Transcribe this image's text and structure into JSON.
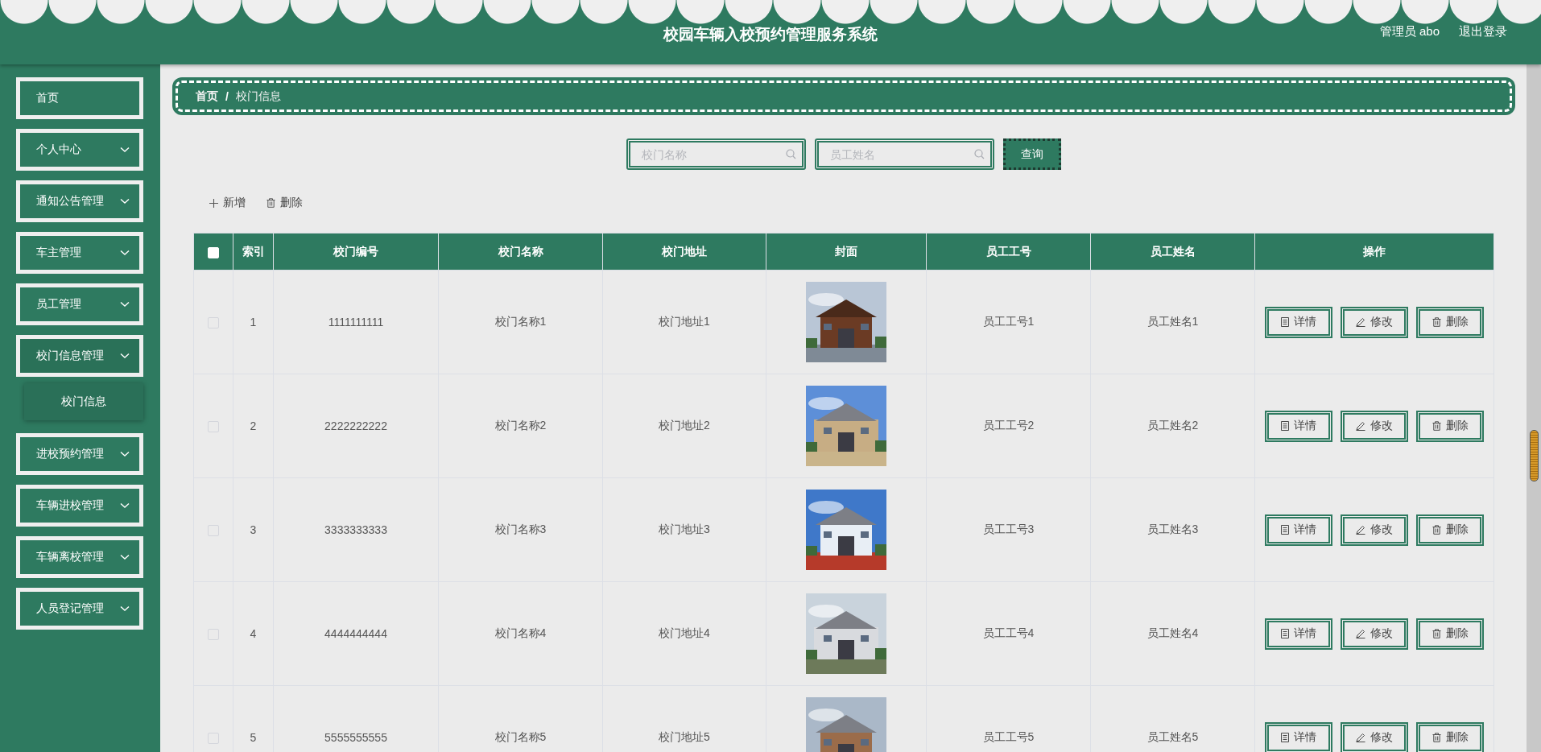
{
  "header": {
    "title": "校园车辆入校预约管理服务系统",
    "user": "管理员 abo",
    "logout": "退出登录"
  },
  "sidebar": {
    "items": [
      {
        "label": "首页",
        "kind": "link"
      },
      {
        "label": "个人中心",
        "kind": "menu"
      },
      {
        "label": "通知公告管理",
        "kind": "menu"
      },
      {
        "label": "车主管理",
        "kind": "menu"
      },
      {
        "label": "员工管理",
        "kind": "menu"
      },
      {
        "label": "校门信息管理",
        "kind": "menu",
        "children": [
          {
            "label": "校门信息",
            "selected": true
          }
        ]
      },
      {
        "label": "进校预约管理",
        "kind": "menu"
      },
      {
        "label": "车辆进校管理",
        "kind": "menu"
      },
      {
        "label": "车辆离校管理",
        "kind": "menu"
      },
      {
        "label": "人员登记管理",
        "kind": "menu"
      }
    ]
  },
  "breadcrumb": {
    "items": [
      "首页",
      "校门信息"
    ],
    "separator": "/"
  },
  "search": {
    "fields": [
      {
        "placeholder": "校门名称"
      },
      {
        "placeholder": "员工姓名"
      }
    ],
    "button": "查询"
  },
  "toolbar": [
    {
      "label": "新增",
      "kind": "add"
    },
    {
      "label": "删除",
      "kind": "delete"
    }
  ],
  "table": {
    "select_all": {
      "checked": false
    },
    "columns": [
      "索引",
      "校门编号",
      "校门名称",
      "校门地址",
      "封面",
      "员工工号",
      "员工姓名",
      "操作"
    ],
    "rows": [
      {
        "checked": false,
        "index": "1",
        "code": "1111111111",
        "name": "校门名称1",
        "address": "校门地址1",
        "staff_no": "员工工号1",
        "staff_name": "员工姓名1",
        "actions": [
          {
            "label": "详情",
            "kind": "detail"
          },
          {
            "label": "修改",
            "kind": "edit"
          },
          {
            "label": "删除",
            "kind": "delete"
          }
        ]
      },
      {
        "checked": false,
        "index": "2",
        "code": "2222222222",
        "name": "校门名称2",
        "address": "校门地址2",
        "staff_no": "员工工号2",
        "staff_name": "员工姓名2",
        "actions": [
          {
            "label": "详情",
            "kind": "detail"
          },
          {
            "label": "修改",
            "kind": "edit"
          },
          {
            "label": "删除",
            "kind": "delete"
          }
        ]
      },
      {
        "checked": false,
        "index": "3",
        "code": "3333333333",
        "name": "校门名称3",
        "address": "校门地址3",
        "staff_no": "员工工号3",
        "staff_name": "员工姓名3",
        "actions": [
          {
            "label": "详情",
            "kind": "detail"
          },
          {
            "label": "修改",
            "kind": "edit"
          },
          {
            "label": "删除",
            "kind": "delete"
          }
        ]
      },
      {
        "checked": false,
        "index": "4",
        "code": "4444444444",
        "name": "校门名称4",
        "address": "校门地址4",
        "staff_no": "员工工号4",
        "staff_name": "员工姓名4",
        "actions": [
          {
            "label": "详情",
            "kind": "detail"
          },
          {
            "label": "修改",
            "kind": "edit"
          },
          {
            "label": "删除",
            "kind": "delete"
          }
        ]
      },
      {
        "checked": false,
        "index": "5",
        "code": "5555555555",
        "name": "校门名称5",
        "address": "校门地址5",
        "staff_no": "员工工号5",
        "staff_name": "员工姓名5",
        "actions": [
          {
            "label": "详情",
            "kind": "detail"
          },
          {
            "label": "修改",
            "kind": "edit"
          },
          {
            "label": "删除",
            "kind": "delete"
          }
        ]
      }
    ]
  }
}
